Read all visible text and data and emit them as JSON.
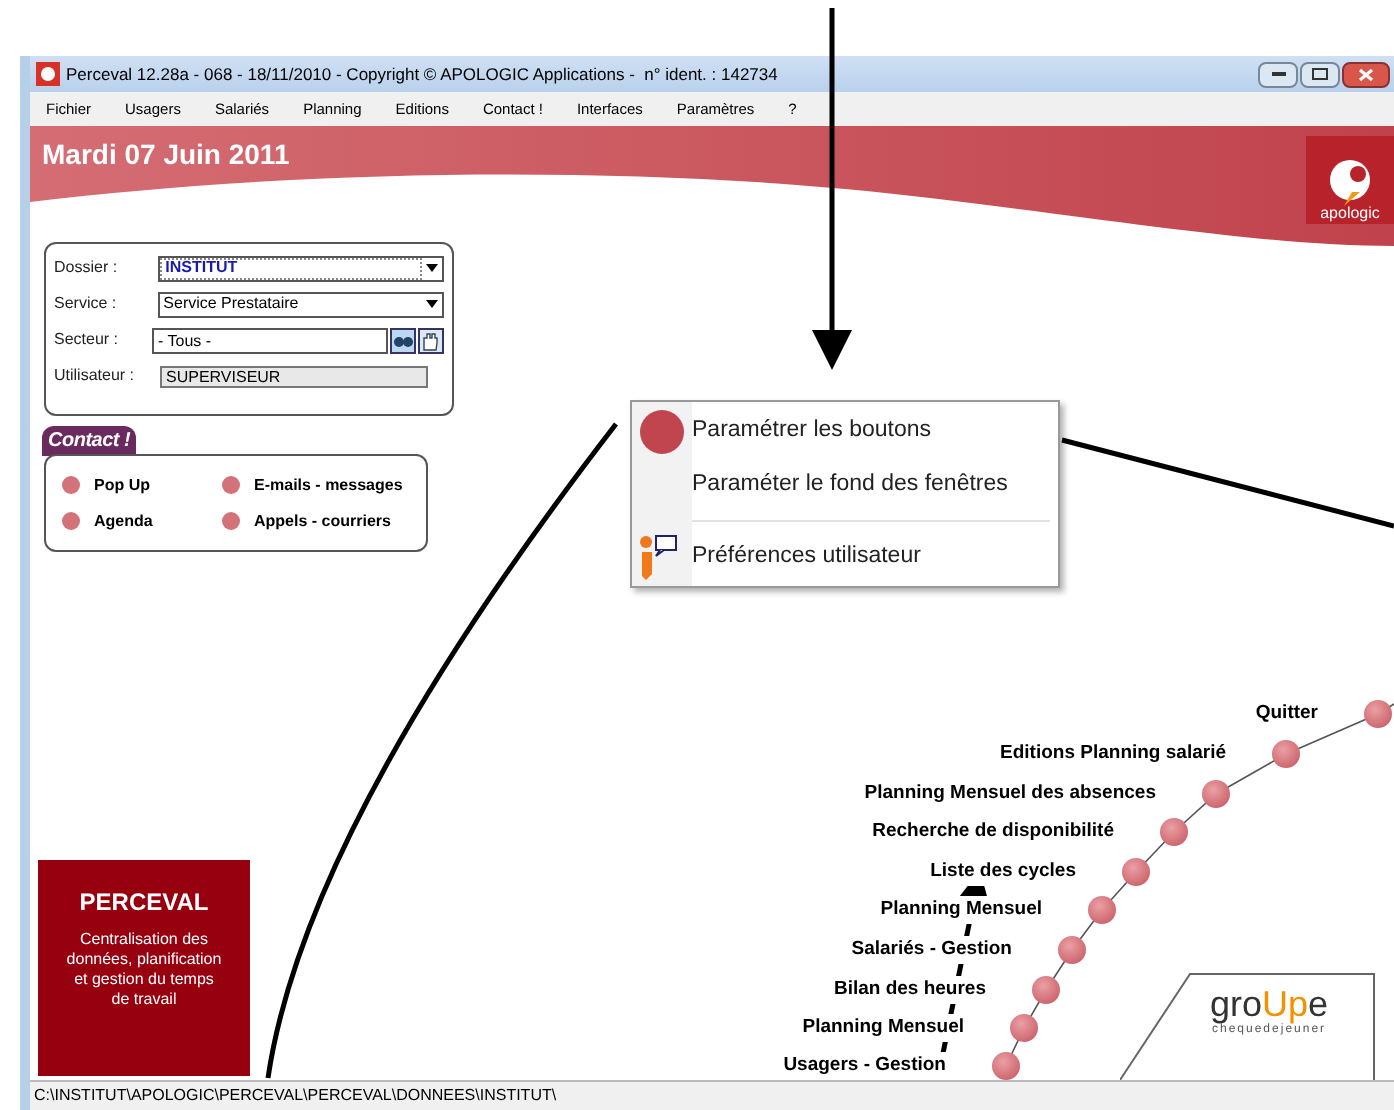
{
  "window": {
    "title": "Perceval 12.28a - 068 - 18/11/2010 - Copyright © APOLOGIC Applications -  n° ident. : 142734"
  },
  "menu": [
    {
      "label": "Fichier"
    },
    {
      "label": "Usagers"
    },
    {
      "label": "Salariés"
    },
    {
      "label": "Planning"
    },
    {
      "label": "Editions"
    },
    {
      "label": "Contact !"
    },
    {
      "label": "Interfaces"
    },
    {
      "label": "Paramètres"
    },
    {
      "label": "?"
    }
  ],
  "banner": {
    "date": "Mardi 07 Juin 2011",
    "logo": "apologic"
  },
  "form": [
    {
      "label": "Dossier :",
      "value": "INSTITUT",
      "kind": "combo-highlight"
    },
    {
      "label": "Service :",
      "value": "Service Prestataire",
      "kind": "combo"
    },
    {
      "label": "Secteur :",
      "value": "- Tous -",
      "kind": "search"
    },
    {
      "label": "Utilisateur :",
      "value": "SUPERVISEUR",
      "kind": "readonly"
    }
  ],
  "contact": {
    "title": "Contact !",
    "items": [
      {
        "label": "Pop Up"
      },
      {
        "label": "E-mails - messages"
      },
      {
        "label": "Agenda"
      },
      {
        "label": "Appels - courriers"
      }
    ]
  },
  "popup_menu": [
    {
      "label": "Paramétrer les boutons",
      "kind": "dot"
    },
    {
      "label": "Paraméter le fond des fenêtres",
      "kind": "plain"
    },
    {
      "label": "Préférences utilisateur",
      "kind": "info"
    }
  ],
  "path_menu": [
    {
      "label": "Quitter"
    },
    {
      "label": "Editions Planning salarié"
    },
    {
      "label": "Planning Mensuel des absences"
    },
    {
      "label": "Recherche de disponibilité"
    },
    {
      "label": "Liste des cycles"
    },
    {
      "label": "Planning Mensuel"
    },
    {
      "label": "Salariés - Gestion"
    },
    {
      "label": "Bilan des heures"
    },
    {
      "label": "Planning Mensuel"
    },
    {
      "label": "Usagers - Gestion"
    }
  ],
  "perceval_card": {
    "title": "PERCEVAL",
    "text": "Centralisation des données, planification et gestion du temps de travail"
  },
  "partner_logo": {
    "name_start": "gro",
    "name_mid": "Up",
    "name_end": "e",
    "tagline": "chequedejeuner"
  },
  "status_bar": {
    "path": "C:\\INSTITUT\\APOLOGIC\\PERCEVAL\\PERCEVAL\\DONNEES\\INSTITUT\\"
  }
}
